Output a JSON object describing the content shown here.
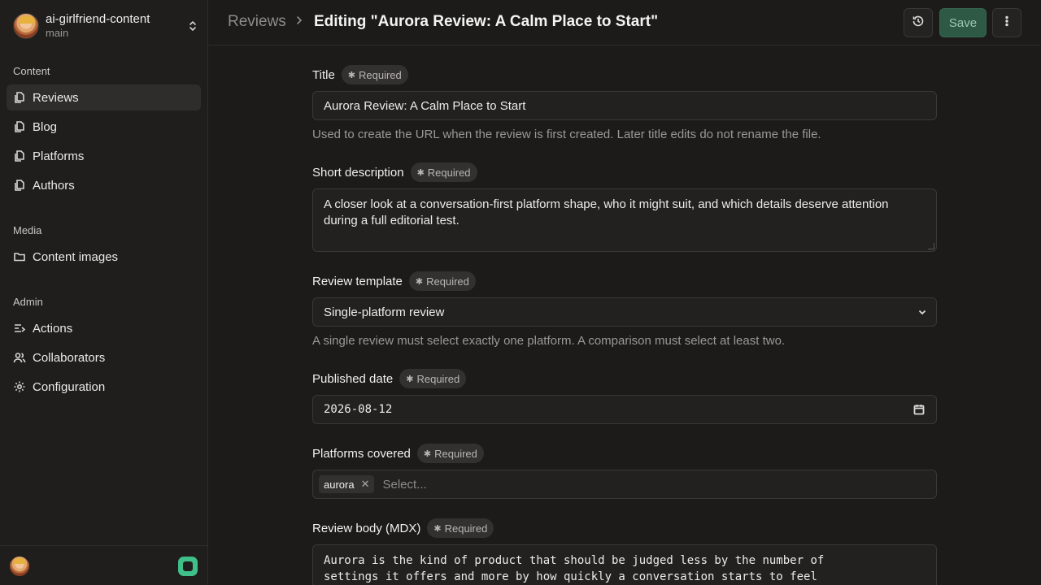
{
  "sidebar": {
    "repo_name": "ai-girlfriend-content",
    "branch": "main",
    "sections": [
      {
        "label": "Content",
        "items": [
          {
            "label": "Reviews",
            "icon": "document-stack-icon",
            "active": true
          },
          {
            "label": "Blog",
            "icon": "document-stack-icon"
          },
          {
            "label": "Platforms",
            "icon": "document-stack-icon"
          },
          {
            "label": "Authors",
            "icon": "document-stack-icon"
          }
        ]
      },
      {
        "label": "Media",
        "items": [
          {
            "label": "Content images",
            "icon": "folder-icon"
          }
        ]
      },
      {
        "label": "Admin",
        "items": [
          {
            "label": "Actions",
            "icon": "list-actions-icon"
          },
          {
            "label": "Collaborators",
            "icon": "users-icon"
          },
          {
            "label": "Configuration",
            "icon": "gear-icon"
          }
        ]
      }
    ]
  },
  "header": {
    "breadcrumb_root": "Reviews",
    "breadcrumb_current": "Editing \"Aurora Review: A Calm Place to Start\"",
    "save_label": "Save"
  },
  "form": {
    "required_label": "Required",
    "title": {
      "label": "Title",
      "value": "Aurora Review: A Calm Place to Start",
      "helper": "Used to create the URL when the review is first created. Later title edits do not rename the file."
    },
    "short_description": {
      "label": "Short description",
      "value": "A closer look at a conversation-first platform shape, who it might suit, and which details deserve attention during a full editorial test."
    },
    "review_template": {
      "label": "Review template",
      "value": "Single-platform review",
      "helper": "A single review must select exactly one platform. A comparison must select at least two."
    },
    "published_date": {
      "label": "Published date",
      "value": "2026-08-12"
    },
    "platforms_covered": {
      "label": "Platforms covered",
      "chips": [
        "aurora"
      ],
      "placeholder": "Select..."
    },
    "review_body": {
      "label": "Review body (MDX)",
      "value": "Aurora is the kind of product that should be judged less by the number of settings it offers and more by how quickly a conversation starts to feel"
    }
  },
  "colors": {
    "accent": "#3fbf8a",
    "save_bg": "#2e5a45",
    "background": "#1c1b1a",
    "sidebar_bg": "#1f1e1d"
  }
}
